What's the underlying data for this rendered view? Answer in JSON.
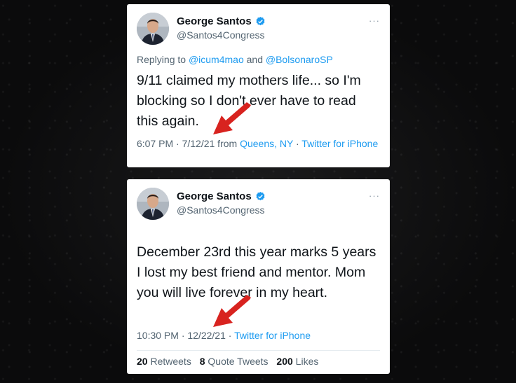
{
  "tweets": [
    {
      "author": {
        "name": "George Santos",
        "handle": "@Santos4Congress"
      },
      "more_label": "···",
      "replying": {
        "prefix": "Replying to ",
        "user1": "@icum4mao",
        "and": " and ",
        "user2": "@BolsonaroSP"
      },
      "text": "9/11 claimed my mothers life... so I'm blocking so I don't ever have to read this again.",
      "meta": {
        "time": "6:07 PM · 7/12/21",
        "from_prefix": " from ",
        "location": "Queens, NY",
        "sep": " · ",
        "client": "Twitter for iPhone"
      }
    },
    {
      "author": {
        "name": "George Santos",
        "handle": "@Santos4Congress"
      },
      "more_label": "···",
      "text": "December 23rd this year marks 5 years I lost my best friend and mentor. Mom you will live forever in my heart.",
      "meta": {
        "time": "10:30 PM · 12/22/21",
        "sep": " · ",
        "client": "Twitter for iPhone"
      },
      "stats": {
        "retweets": {
          "count": "20",
          "label": " Retweets"
        },
        "quotes": {
          "count": "8",
          "label": " Quote Tweets"
        },
        "likes": {
          "count": "200",
          "label": " Likes"
        }
      }
    }
  ],
  "colors": {
    "link": "#1d9bf0",
    "verified": "#1d9bf0",
    "arrow": "#d8231f",
    "background": "#0e0e0f"
  }
}
